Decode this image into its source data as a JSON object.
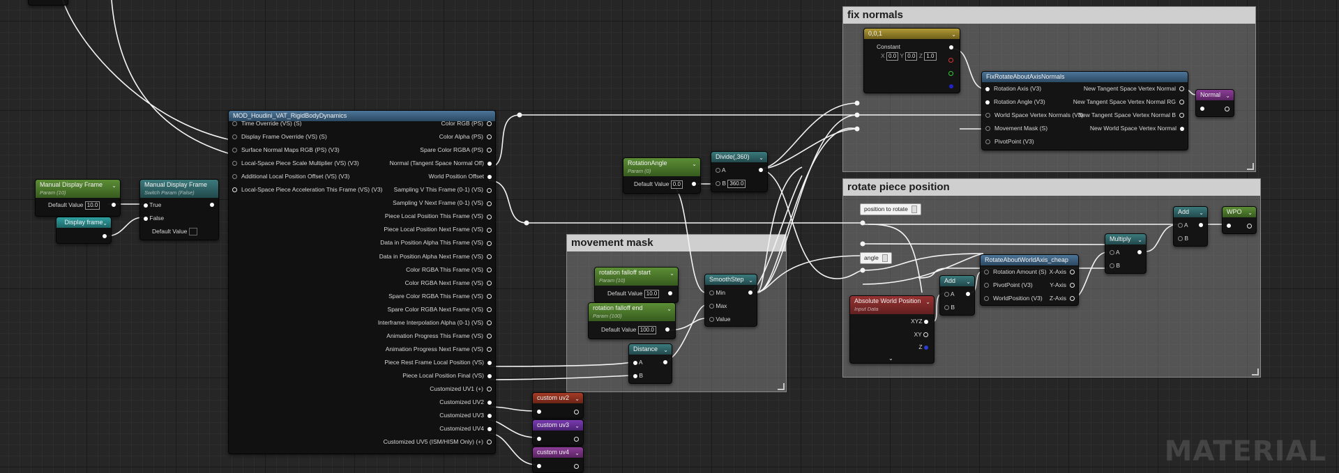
{
  "nodes": {
    "main": {
      "title": "MOD_Houdini_VAT_RigidBodyDynamics",
      "inputs": [
        "Time Override (VS) (S)",
        "Display Frame Override (VS) (S)",
        "Surface Normal Maps RGB (PS) (V3)",
        "Local-Space Piece Scale Multiplier (VS) (V3)",
        "Additional Local Position Offset (VS) (V3)",
        "Local-Space Piece Acceleration This Frame (VS) (V3)"
      ],
      "outputs": [
        "Color RGB (PS)",
        "Color Alpha (PS)",
        "Spare Color RGBA (PS)",
        "Normal (Tangent Space Normal Off)",
        "World Position Offset",
        "Sampling V This Frame (0-1) (VS)",
        "Sampling V Next Frame (0-1) (VS)",
        "Piece Local Position This Frame (VS)",
        "Piece Local Position Next Frame (VS)",
        "Data in Position Alpha This Frame (VS)",
        "Data in Position Alpha Next Frame (VS)",
        "Color RGBA This Frame (VS)",
        "Color RGBA Next Frame (VS)",
        "Spare Color RGBA This Frame (VS)",
        "Spare Color RGBA Next Frame (VS)",
        "Interframe Interpolation Alpha (0-1) (VS)",
        "Animation Progress This Frame (VS)",
        "Animation Progress Next Frame (VS)",
        "Piece Rest Frame Local Position (VS)",
        "Piece Local Position Final (VS)",
        "Customized UV1 (+)",
        "Customized UV2",
        "Customized UV3",
        "Customized UV4",
        "Customized UV5 (ISM/HISM Only) (+)"
      ]
    },
    "manual_param": {
      "title": "Manual Display Frame",
      "subtitle": "Param (10)",
      "field_label": "Default Value",
      "value": "10.0"
    },
    "switch_param": {
      "title": "Manual Display Frame",
      "subtitle": "Switch Param (False)",
      "true_label": "True",
      "false_label": "False",
      "default_label": "Default Value"
    },
    "display_frame": {
      "title": "Display frame"
    },
    "rotation_angle": {
      "title": "RotationAngle",
      "subtitle": "Param (0)",
      "field_label": "Default Value",
      "value": "0.0"
    },
    "divide": {
      "title": "Divide(,360)",
      "a_label": "A",
      "b_label": "B",
      "b_value": "360.0"
    },
    "rot_falloff_start": {
      "title": "rotation falloff start",
      "subtitle": "Param (10)",
      "field_label": "Default Value",
      "value": "10.0"
    },
    "rot_falloff_end": {
      "title": "rotation falloff end",
      "subtitle": "Param (100)",
      "field_label": "Default Value",
      "value": "100.0"
    },
    "smoothstep": {
      "title": "SmoothStep",
      "pins": [
        "Min",
        "Max",
        "Value"
      ]
    },
    "distance": {
      "title": "Distance",
      "a_label": "A",
      "b_label": "B"
    },
    "constant": {
      "title": "0,0,1",
      "subtitle": "Constant",
      "x_label": "X",
      "x": "0.0",
      "y_label": "Y",
      "y": "0.0",
      "z_label": "Z",
      "z": "1.0"
    },
    "fix_rotate": {
      "title": "FixRotateAboutAxisNormals",
      "inputs": [
        "Rotation Axis (V3)",
        "Rotation Angle (V3)",
        "World Space Vertex Normals (V3)",
        "Movement Mask (S)",
        "PivotPoint (V3)"
      ],
      "outputs": [
        "New Tangent Space Vertex Normal",
        "New Tangent Space Vertex Normal RG",
        "New Tangent Space Vertex Normal B",
        "New World Space Vertex Normal"
      ]
    },
    "normal_reroute": {
      "title": "Normal"
    },
    "add_wpo": {
      "title": "Add",
      "a_label": "A",
      "b_label": "B"
    },
    "wpo_reroute": {
      "title": "WPO"
    },
    "multiply": {
      "title": "Multiply",
      "a_label": "A",
      "b_label": "B"
    },
    "rotate_world": {
      "title": "RotateAboutWorldAxis_cheap",
      "inputs": [
        "Rotation Amount (S)",
        "PivotPoint (V3)",
        "WorldPosition (V3)"
      ],
      "outputs": [
        "X-Axis",
        "Y-Axis",
        "Z-Axis"
      ]
    },
    "add_pivot": {
      "title": "Add",
      "a_label": "A",
      "b_label": "B"
    },
    "abs_world_pos": {
      "title": "Absolute World Position",
      "subtitle": "Input Data",
      "outputs": [
        "XYZ",
        "XY",
        "Z"
      ]
    },
    "custom_uv2": {
      "title": "custom uv2"
    },
    "custom_uv3": {
      "title": "custom uv3"
    },
    "custom_uv4": {
      "title": "custom uv4"
    },
    "ghost_position": {
      "label": "position to rotate"
    },
    "ghost_angle": {
      "label": "angle"
    }
  },
  "comments": {
    "fix_normals": "fix normals",
    "rotate_piece": "rotate piece position",
    "movement_mask": "movement mask"
  },
  "watermark": "MATERIAL",
  "colors": {
    "background": "#262626",
    "comment_bg": "#9b9b9b",
    "wire": "#ffffff"
  }
}
